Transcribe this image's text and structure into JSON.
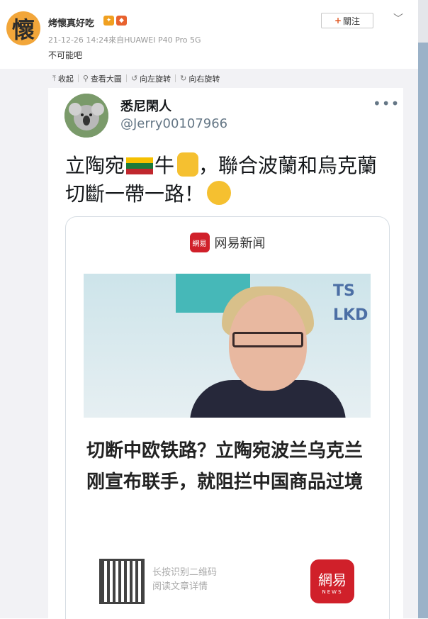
{
  "post": {
    "avatar_char": "懷",
    "username": "烤懷真好吃",
    "meta": "21-12-26 14:24來自HUAWEI P40 Pro 5G",
    "text": "不可能吧",
    "follow_label": "關注"
  },
  "toolbar": {
    "collapse": "收起",
    "view_large": "查看大圖",
    "rotate_left": "向左旋转",
    "rotate_right": "向右旋转"
  },
  "tweet": {
    "name": "悉尼閑人",
    "handle": "@Jerry00107966",
    "more": "•••",
    "text_part1": "立陶宛",
    "text_part2": "牛",
    "text_part3": "，聯合波蘭和烏克蘭切斷一帶一路！",
    "card": {
      "source_logo": "網易",
      "source_name": "网易新闻",
      "photo_logo": "TS\nLKD",
      "title": "切断中欧铁路？立陶宛波兰乌克兰刚宣布联手，就阻拦中国商品过境",
      "qr_line1": "长按识别二维码",
      "qr_line2": "阅读文章详情",
      "news_logo": "網易",
      "news_logo_sub": "NEWS"
    }
  },
  "colors": {
    "accent_orange": "#e0561f",
    "netease_red": "#d0202a",
    "toolbar_bg": "#f2f2f5"
  },
  "icons": [
    "collapse-icon",
    "search-icon",
    "rotate-left-icon",
    "rotate-right-icon",
    "chevron-down-icon",
    "more-icon"
  ]
}
